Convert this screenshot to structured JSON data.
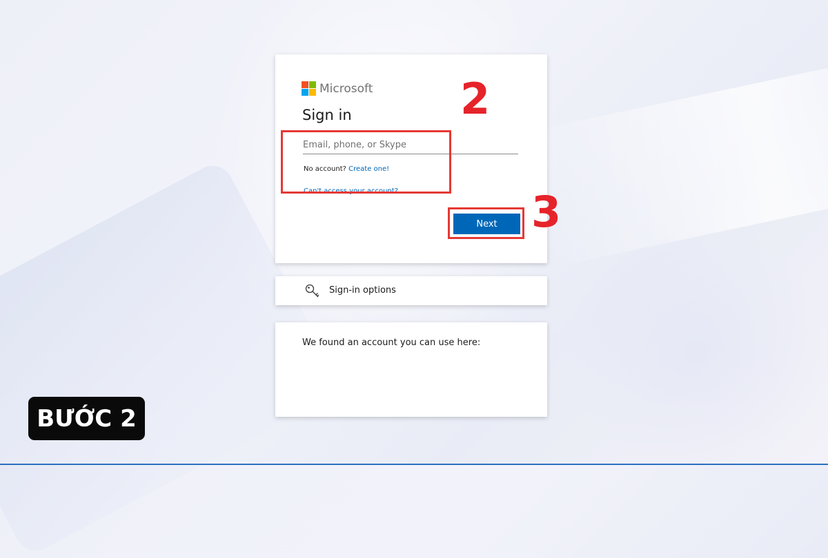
{
  "brand": {
    "name": "Microsoft",
    "logo_colors": [
      "#f25022",
      "#7fba00",
      "#00a4ef",
      "#ffb900"
    ]
  },
  "signin": {
    "title": "Sign in",
    "email_placeholder": "Email, phone, or Skype",
    "email_value": "",
    "no_account_text": "No account?",
    "create_link": "Create one!",
    "cant_access": "Can't access your account?",
    "next_label": "Next"
  },
  "options": {
    "label": "Sign-in options",
    "icon": "key-icon"
  },
  "found_account": {
    "text": "We found an account you can use here:"
  },
  "annotations": {
    "step_input": "2",
    "step_next": "3",
    "badge": "BƯỚC 2",
    "highlight_color": "#e53935"
  },
  "colors": {
    "accent": "#0067b8",
    "annotation_red": "#e6232a"
  }
}
